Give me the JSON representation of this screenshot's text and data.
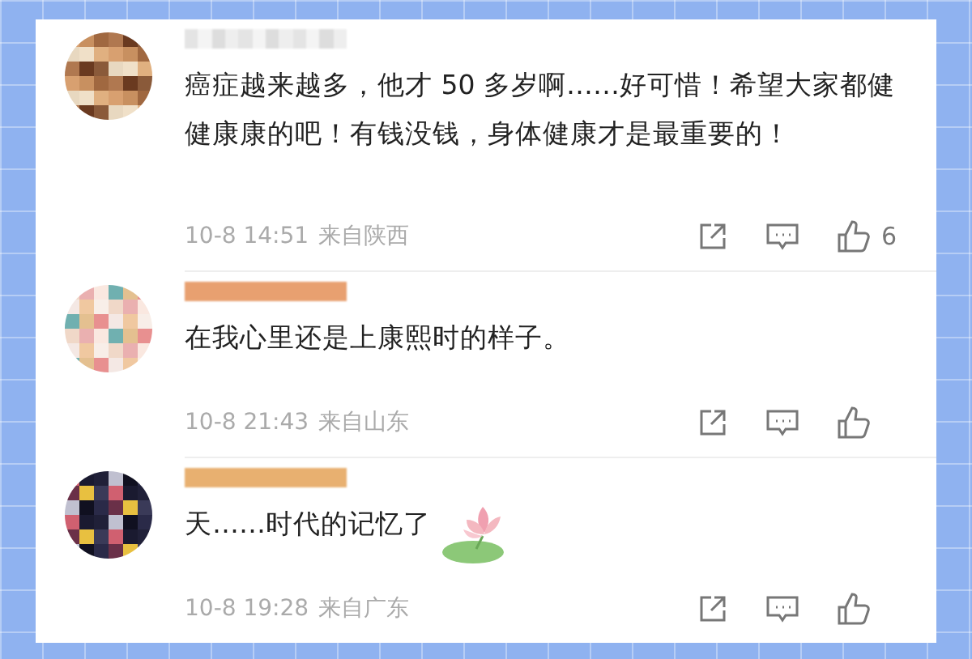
{
  "comments": [
    {
      "text": "癌症越来越多，他才 50 多岁啊……好可惜！希望大家都健健康康的吧！有钱没钱，身体健康才是最重要的！",
      "time": "10-8 14:51",
      "source": "来自陕西",
      "likes": "6",
      "sticker": false
    },
    {
      "text": "在我心里还是上康熙时的样子。",
      "time": "10-8 21:43",
      "source": "来自山东",
      "sticker": false
    },
    {
      "text": "天……时代的记忆了",
      "time": "10-8 19:28",
      "source": "来自广东",
      "sticker": true
    }
  ]
}
